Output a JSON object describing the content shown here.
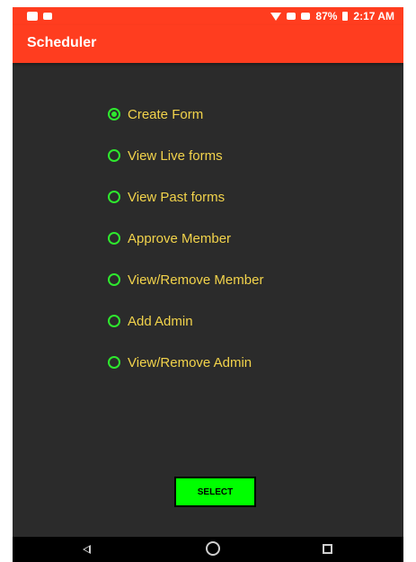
{
  "status_bar": {
    "battery": "87%",
    "time": "2:17 AM"
  },
  "app_bar": {
    "title": "Scheduler"
  },
  "options": [
    {
      "label": "Create Form",
      "checked": true
    },
    {
      "label": "View Live forms",
      "checked": false
    },
    {
      "label": "View Past forms",
      "checked": false
    },
    {
      "label": "Approve Member",
      "checked": false
    },
    {
      "label": "View/Remove Member",
      "checked": false
    },
    {
      "label": "Add Admin",
      "checked": false
    },
    {
      "label": "View/Remove Admin",
      "checked": false
    }
  ],
  "select_button": {
    "label": "SELECT"
  },
  "colors": {
    "app_bar": "#ff3d1f",
    "background": "#2b2b2b",
    "radio": "#2ee82e",
    "label": "#f2d34b",
    "button": "#00ff00"
  },
  "icons": {
    "nav_back": "back-triangle",
    "nav_home": "home-circle",
    "nav_recent": "recent-square"
  }
}
